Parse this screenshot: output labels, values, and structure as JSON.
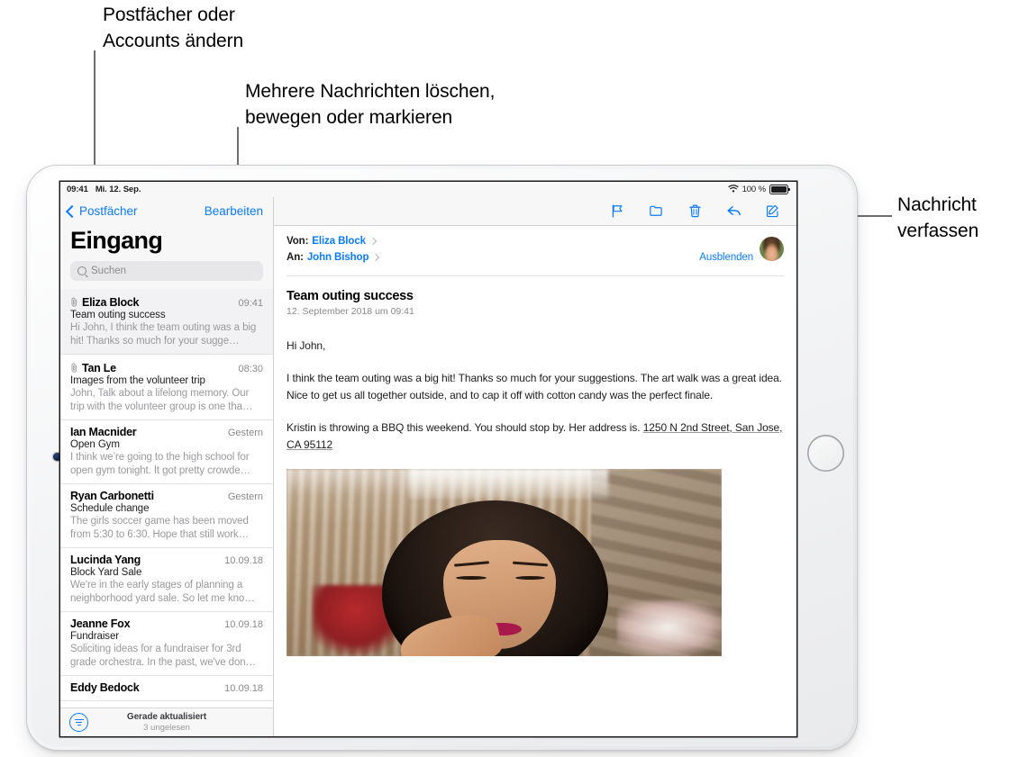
{
  "callouts": {
    "mailboxes": "Postfächer oder\nAccounts ändern",
    "edit": "Mehrere Nachrichten löschen,\nbewegen oder markieren",
    "compose": "Nachricht\nverfassen"
  },
  "status_bar": {
    "time": "09:41",
    "date": "Mi. 12. Sep.",
    "battery_percent": "100 %",
    "wifi_icon": "wifi-icon",
    "battery_icon": "battery-full-icon"
  },
  "sidebar": {
    "back_button": "Postfächer",
    "edit_button": "Bearbeiten",
    "title": "Eingang",
    "search_placeholder": "Suchen",
    "messages": [
      {
        "sender": "Eliza Block",
        "date": "09:41",
        "subject": "Team outing success",
        "preview": "Hi John, I think the team outing was a big hit! Thanks so much for your sugge…",
        "attachment": true,
        "selected": true
      },
      {
        "sender": "Tan Le",
        "date": "08:30",
        "subject": "Images from the volunteer trip",
        "preview": "John, Talk about a lifelong memory. Our trip with the volunteer group is one tha…",
        "attachment": true,
        "selected": false
      },
      {
        "sender": "Ian Macnider",
        "date": "Gestern",
        "subject": "Open Gym",
        "preview": "I think we’re going to the high school for open gym tonight. It got pretty crowde…",
        "attachment": false,
        "selected": false
      },
      {
        "sender": "Ryan Carbonetti",
        "date": "Gestern",
        "subject": "Schedule change",
        "preview": "The girls soccer game has been moved from 5:30 to 6:30. Hope that still work…",
        "attachment": false,
        "selected": false
      },
      {
        "sender": "Lucinda Yang",
        "date": "10.09.18",
        "subject": "Block Yard Sale",
        "preview": "We're in the early stages of planning a neighborhood yard sale. So let me kno…",
        "attachment": false,
        "selected": false
      },
      {
        "sender": "Jeanne Fox",
        "date": "10.09.18",
        "subject": "Fundraiser",
        "preview": "Soliciting ideas for a fundraiser for 3rd grade orchestra. In the past, we've don…",
        "attachment": false,
        "selected": false
      },
      {
        "sender": "Eddy Bedock",
        "date": "10.09.18",
        "subject": "",
        "preview": "",
        "attachment": false,
        "selected": false
      }
    ],
    "footer": {
      "status_main": "Gerade aktualisiert",
      "status_sub": "3 ungelesen",
      "filter_icon": "filter-icon"
    }
  },
  "detail": {
    "toolbar": [
      {
        "icon": "flag-icon"
      },
      {
        "icon": "folder-icon"
      },
      {
        "icon": "trash-icon"
      },
      {
        "icon": "reply-icon"
      },
      {
        "icon": "compose-icon"
      }
    ],
    "from_label": "Von:",
    "from_value": "Eliza Block",
    "to_label": "An:",
    "to_value": "John Bishop",
    "hide_button": "Ausblenden",
    "subject": "Team outing success",
    "timestamp": "12. September 2018 um 09:41",
    "body": {
      "greeting": "Hi John,",
      "paragraph1": "I think the team outing was a big hit! Thanks so much for your suggestions. The art walk was a great idea. Nice to get us all together outside, and to cap it off with cotton candy was the perfect finale.",
      "paragraph2_pre": "Kristin is throwing a BBQ this weekend. You should stop by. Her address is. ",
      "paragraph2_address": "1250 N 2nd Street, San Jose, CA 95112"
    }
  },
  "colors": {
    "accent_blue": "#0b7bff",
    "selected_row": "#f2f2f4",
    "chrome_gray": "#f7f7f7"
  }
}
